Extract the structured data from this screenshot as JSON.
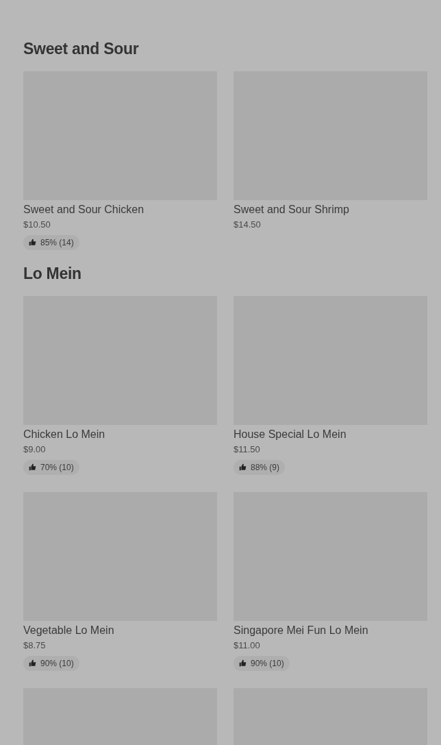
{
  "sections": [
    {
      "title": "Sweet and Sour",
      "items": [
        {
          "kind": "dish",
          "name": "Sweet and Sour Chicken",
          "price": "$10.50",
          "rating": "85% (14)"
        },
        {
          "kind": "dish",
          "name": "Sweet and Sour Shrimp",
          "price": "$14.50"
        }
      ]
    },
    {
      "title": "Lo Mein",
      "items": [
        {
          "kind": "dish",
          "name": "Chicken Lo Mein",
          "price": "$9.00",
          "rating": "70% (10)"
        },
        {
          "kind": "dish",
          "name": "House Special Lo Mein",
          "price": "$11.50",
          "rating": "88% (9)"
        },
        {
          "kind": "dish",
          "name": "Vegetable Lo Mein",
          "price": "$8.75",
          "rating": "90% (10)"
        },
        {
          "kind": "dish",
          "name": "Singapore Mei Fun Lo Mein",
          "price": "$11.00",
          "rating": "90% (10)"
        },
        {
          "kind": "cut"
        },
        {
          "kind": "cut"
        }
      ]
    }
  ]
}
